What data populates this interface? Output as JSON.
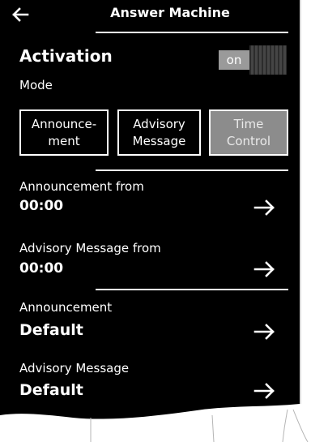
{
  "header": {
    "title": "Answer Machine",
    "back_icon": "arrow-left-icon"
  },
  "activation": {
    "label": "Activation",
    "toggle_state": "on"
  },
  "mode": {
    "label": "Mode",
    "options": [
      {
        "label": "Announce-\nment",
        "selected": false
      },
      {
        "label": "Advisory\nMessage",
        "selected": false
      },
      {
        "label": "Time\nControl",
        "selected": true
      }
    ]
  },
  "rows": [
    {
      "label": "Announcement from",
      "value": "00:00",
      "icon": "arrow-right-icon"
    },
    {
      "label": "Advisory Message from",
      "value": "00:00",
      "icon": "arrow-right-icon"
    },
    {
      "label": "Announcement",
      "value": "Default",
      "icon": "arrow-right-icon"
    },
    {
      "label": "Advisory Message",
      "value": "Default",
      "icon": "arrow-right-icon"
    }
  ],
  "colors": {
    "screen_bg": "#000000",
    "text": "#ffffff",
    "selected_button": "#8c8c8c",
    "toggle_on": "#9a9a9a"
  }
}
